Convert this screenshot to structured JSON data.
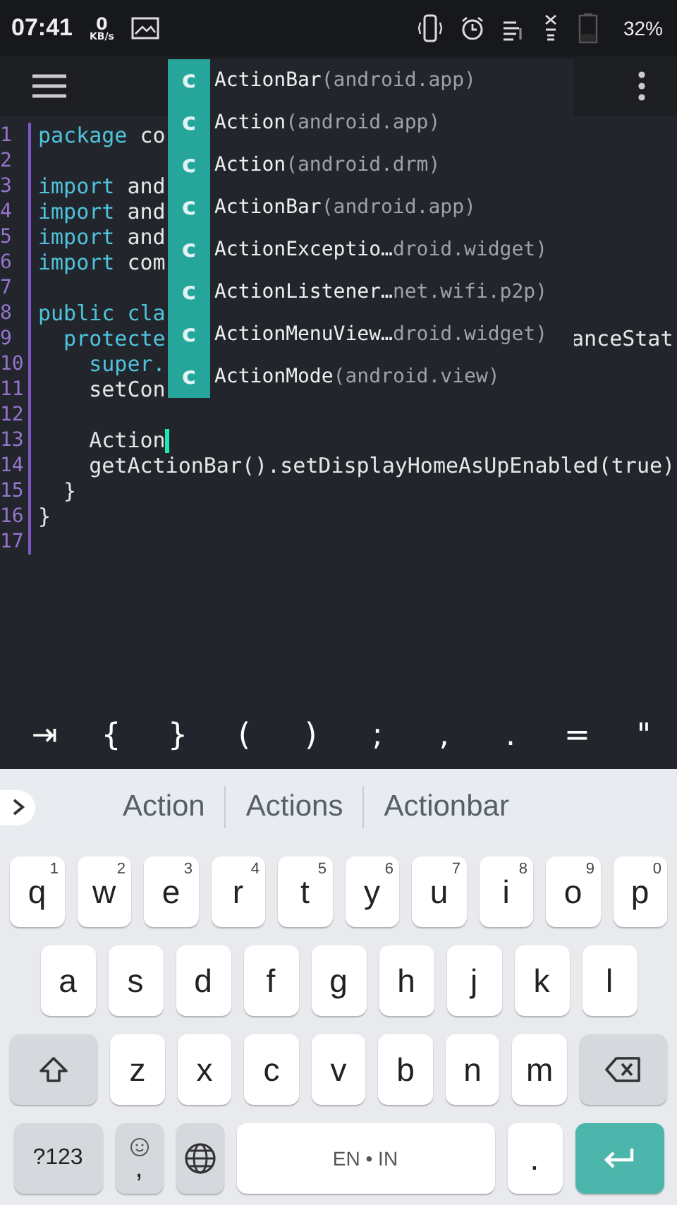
{
  "status_bar": {
    "time": "07:41",
    "speed_value": "0",
    "speed_unit": "KB/s",
    "battery": "32%"
  },
  "editor": {
    "lines": [
      {
        "number": "1",
        "parts": [
          {
            "text": "package",
            "kind": "keyword"
          },
          {
            "text": " co",
            "kind": "plain"
          }
        ]
      },
      {
        "number": "2"
      },
      {
        "number": "3",
        "parts": [
          {
            "text": "import",
            "kind": "keyword"
          },
          {
            "text": " and",
            "kind": "plain"
          }
        ]
      },
      {
        "number": "4",
        "parts": [
          {
            "text": "import",
            "kind": "keyword"
          },
          {
            "text": " and",
            "kind": "plain"
          }
        ]
      },
      {
        "number": "5",
        "parts": [
          {
            "text": "import",
            "kind": "keyword"
          },
          {
            "text": " and",
            "kind": "plain"
          }
        ]
      },
      {
        "number": "6",
        "parts": [
          {
            "text": "import",
            "kind": "keyword"
          },
          {
            "text": " com",
            "kind": "plain"
          }
        ]
      },
      {
        "number": "7"
      },
      {
        "number": "8",
        "parts": [
          {
            "text": "public",
            "kind": "keyword"
          },
          {
            "text": " cla",
            "kind": "keyword"
          }
        ]
      },
      {
        "number": "9",
        "parts": [
          {
            "text": "  protecte",
            "kind": "keyword"
          }
        ],
        "after_popup": "anceStat"
      },
      {
        "number": "10",
        "parts": [
          {
            "text": "    super.",
            "kind": "keyword"
          }
        ]
      },
      {
        "number": "11",
        "parts": [
          {
            "text": "    setCon",
            "kind": "plain"
          }
        ]
      },
      {
        "number": "12"
      },
      {
        "number": "13",
        "parts": [
          {
            "text": "    Action",
            "kind": "plain"
          }
        ],
        "cursor": true
      },
      {
        "number": "14",
        "parts": [
          {
            "text": "    getActionBar().setDisplayHomeAsUpEnabled(true)",
            "kind": "plain"
          }
        ]
      },
      {
        "number": "15",
        "parts": [
          {
            "text": "  }",
            "kind": "plain"
          }
        ]
      },
      {
        "number": "16",
        "parts": [
          {
            "text": "}",
            "kind": "plain"
          }
        ]
      },
      {
        "number": "17"
      }
    ]
  },
  "completions": [
    {
      "badge": "c",
      "name": "ActionBar",
      "detail": "(android.app)"
    },
    {
      "badge": "c",
      "name": "Action",
      "detail": "(android.app)"
    },
    {
      "badge": "c",
      "name": "Action",
      "detail": "(android.drm)"
    },
    {
      "badge": "c",
      "name": "ActionBar",
      "detail": "(android.app)"
    },
    {
      "badge": "c",
      "name": "ActionExceptio…",
      "detail": "droid.widget)"
    },
    {
      "badge": "c",
      "name": "ActionListener…",
      "detail": "net.wifi.p2p)"
    },
    {
      "badge": "c",
      "name": "ActionMenuView…",
      "detail": "droid.widget)"
    },
    {
      "badge": "c",
      "name": "ActionMode",
      "detail": "(android.view)"
    }
  ],
  "symbol_bar": [
    "⇥",
    "{",
    "}",
    "(",
    ")",
    ";",
    ",",
    ".",
    "=",
    "\""
  ],
  "suggestions": [
    "Action",
    "Actions",
    "Actionbar"
  ],
  "keyboard": {
    "rows": [
      {
        "keys": [
          {
            "kind": "letter",
            "label": "q",
            "hint": "1"
          },
          {
            "kind": "letter",
            "label": "w",
            "hint": "2"
          },
          {
            "kind": "letter",
            "label": "e",
            "hint": "3"
          },
          {
            "kind": "letter",
            "label": "r",
            "hint": "4"
          },
          {
            "kind": "letter",
            "label": "t",
            "hint": "5"
          },
          {
            "kind": "letter",
            "label": "y",
            "hint": "6"
          },
          {
            "kind": "letter",
            "label": "u",
            "hint": "7"
          },
          {
            "kind": "letter",
            "label": "i",
            "hint": "8"
          },
          {
            "kind": "letter",
            "label": "o",
            "hint": "9"
          },
          {
            "kind": "letter",
            "label": "p",
            "hint": "0"
          }
        ]
      },
      {
        "keys": [
          {
            "kind": "letter",
            "label": "a"
          },
          {
            "kind": "letter",
            "label": "s"
          },
          {
            "kind": "letter",
            "label": "d"
          },
          {
            "kind": "letter",
            "label": "f"
          },
          {
            "kind": "letter",
            "label": "g"
          },
          {
            "kind": "letter",
            "label": "h"
          },
          {
            "kind": "letter",
            "label": "j"
          },
          {
            "kind": "letter",
            "label": "k"
          },
          {
            "kind": "letter",
            "label": "l"
          }
        ]
      },
      {
        "keys": [
          {
            "kind": "shift"
          },
          {
            "kind": "letter",
            "label": "z"
          },
          {
            "kind": "letter",
            "label": "x"
          },
          {
            "kind": "letter",
            "label": "c"
          },
          {
            "kind": "letter",
            "label": "v"
          },
          {
            "kind": "letter",
            "label": "b"
          },
          {
            "kind": "letter",
            "label": "n"
          },
          {
            "kind": "letter",
            "label": "m"
          },
          {
            "kind": "backspace"
          }
        ]
      },
      {
        "keys": [
          {
            "kind": "symbols",
            "label": "?123"
          },
          {
            "kind": "emoji",
            "label": ","
          },
          {
            "kind": "globe"
          },
          {
            "kind": "space",
            "label": "EN • IN"
          },
          {
            "kind": "letter",
            "label": "."
          },
          {
            "kind": "enter"
          }
        ]
      }
    ]
  }
}
